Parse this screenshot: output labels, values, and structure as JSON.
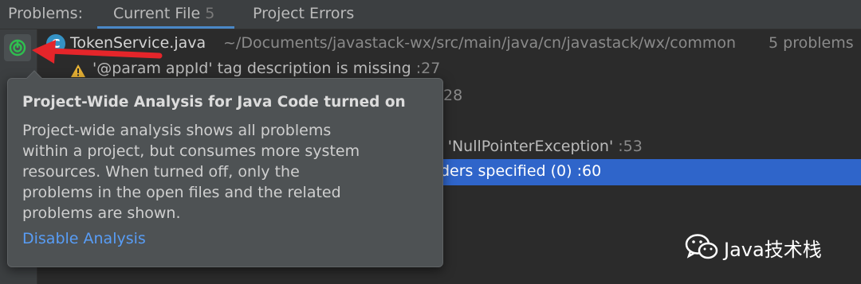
{
  "tabbar": {
    "title": "Problems:",
    "tabs": [
      {
        "label": "Current File",
        "count": "5"
      },
      {
        "label": "Project Errors"
      }
    ]
  },
  "file": {
    "name": "TokenService.java",
    "icon_letter": "C",
    "path": "~/Documents/javastack-wx/src/main/java/cn/javastack/wx/common",
    "problems": "5 problems"
  },
  "issues": [
    {
      "text": "'@param appId' tag description is missing",
      "line": ":27"
    },
    {
      "text": "",
      "line": "28"
    },
    {
      "text": "e 'NullPointerException'",
      "line": ":53"
    },
    {
      "text": "ders specified (0)",
      "line": ":60"
    }
  ],
  "popup": {
    "title": "Project-Wide Analysis for Java Code turned on",
    "body": "Project-wide analysis shows all problems within a project, but consumes more system resources. When turned off, only the problems in the open files and the related problems are shown.",
    "link": "Disable Analysis"
  },
  "watermark": {
    "text": "Java技术栈"
  },
  "colors": {
    "accent": "#4a88c7",
    "selection": "#2f65ca",
    "link": "#589df6",
    "arrow": "#e5252a",
    "analysis_icon": "#2fbf4f"
  }
}
